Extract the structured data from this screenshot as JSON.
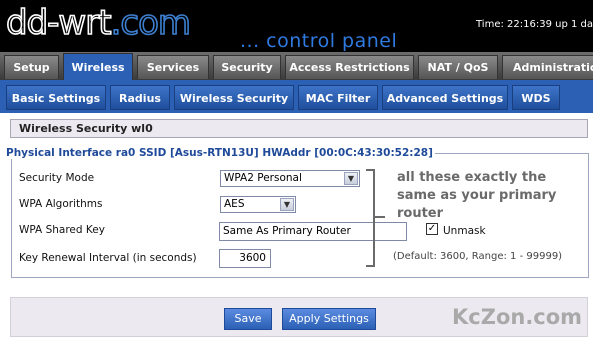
{
  "header": {
    "logo_main": "dd-wrt",
    "logo_suffix": ".com",
    "subtitle": "... control panel",
    "time_text": "Time: 22:16:39 up 1 day"
  },
  "main_tabs": [
    "Setup",
    "Wireless",
    "Services",
    "Security",
    "Access Restrictions",
    "NAT / QoS",
    "Administration"
  ],
  "active_main_tab": "Wireless",
  "sub_tabs": [
    "Basic Settings",
    "Radius",
    "Wireless Security",
    "MAC Filter",
    "Advanced Settings",
    "WDS"
  ],
  "active_sub_tab": "Wireless Security",
  "section": {
    "title": "Wireless Security wl0",
    "interface_title": "Physical Interface ra0 SSID [Asus-RTN13U] HWAddr [00:0C:43:30:52:28]"
  },
  "fields": {
    "security_mode": {
      "label": "Security Mode",
      "value": "WPA2 Personal"
    },
    "wpa_algorithms": {
      "label": "WPA Algorithms",
      "value": "AES"
    },
    "wpa_shared_key": {
      "label": "WPA Shared Key",
      "value": "Same As Primary Router"
    },
    "unmask": {
      "label": "Unmask",
      "checked": true
    },
    "key_renewal": {
      "label": "Key Renewal Interval (in seconds)",
      "value": "3600",
      "hint": "(Default: 3600, Range: 1 - 99999)"
    }
  },
  "annotation": "all these exactly the same as your primary router",
  "buttons": {
    "save": "Save",
    "apply": "Apply Settings"
  },
  "watermark": "KcZon.com",
  "colors": {
    "accent": "#2b60b5",
    "header_bg": "#000000",
    "annotation": "#6a6a6a"
  }
}
